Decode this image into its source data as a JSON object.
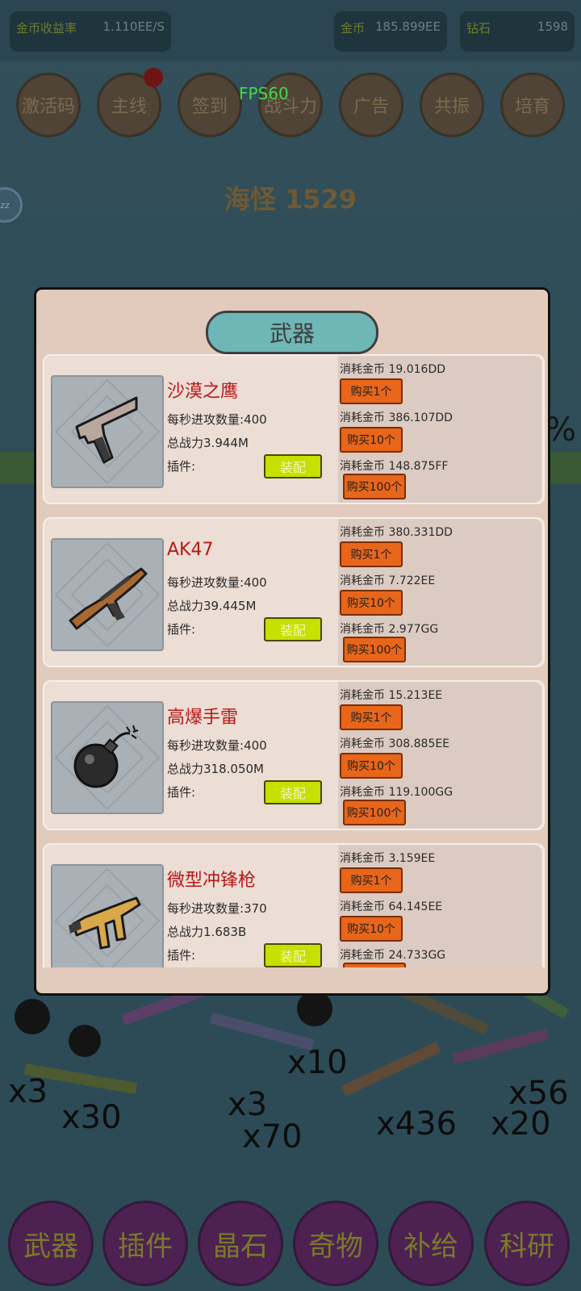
{
  "topbar": {
    "income_label": "金币收益率",
    "income_value": "1.110EE/S",
    "gold_label": "金币",
    "gold_value": "185.899EE",
    "diamond_label": "钻石",
    "diamond_value": "1598"
  },
  "menu": [
    "激活码",
    "主线",
    "签到",
    "战斗力",
    "广告",
    "共振",
    "培育"
  ],
  "fps": "FPS60",
  "side_icon_text": "zz",
  "boss_text": "海怪 1529",
  "percent_text": "%",
  "bottom_nav": [
    "武器",
    "插件",
    "晶石",
    "奇物",
    "补给",
    "科研"
  ],
  "scene_numbers": [
    "x3",
    "x30",
    "x70",
    "x3",
    "x10",
    "x436",
    "x20",
    "x56"
  ],
  "dialog": {
    "title": "武器",
    "labels": {
      "attacks": "每秒进攻数量:",
      "power": "总战力",
      "plugin": "插件:",
      "equip": "装配",
      "cost": "消耗金币",
      "buy1": "购买1个",
      "buy10": "购买10个",
      "buy100": "购买100个"
    },
    "weapons": [
      {
        "name": "沙漠之鹰",
        "icon": "pistol-icon",
        "attacks_value": "400",
        "power_value": "3.944M",
        "cost1": "19.016DD",
        "cost10": "386.107DD",
        "cost100": "148.875FF"
      },
      {
        "name": "AK47",
        "icon": "rifle-icon",
        "attacks_value": "400",
        "power_value": "39.445M",
        "cost1": "380.331DD",
        "cost10": "7.722EE",
        "cost100": "2.977GG"
      },
      {
        "name": "高爆手雷",
        "icon": "bomb-icon",
        "attacks_value": "400",
        "power_value": "318.050M",
        "cost1": "15.213EE",
        "cost10": "308.885EE",
        "cost100": "119.100GG"
      },
      {
        "name": "微型冲锋枪",
        "icon": "smg-icon",
        "attacks_value": "370",
        "power_value": "1.683B",
        "cost1": "3.159EE",
        "cost10": "64.145EE",
        "cost100": "24.733GG"
      }
    ]
  },
  "colors": {
    "dialog_bg": "#e2cbbd",
    "title_bg": "#6fb6b6",
    "weapon_name": "#b81818",
    "buy_button": "#e8661a",
    "equip_button": "#c6e000"
  }
}
